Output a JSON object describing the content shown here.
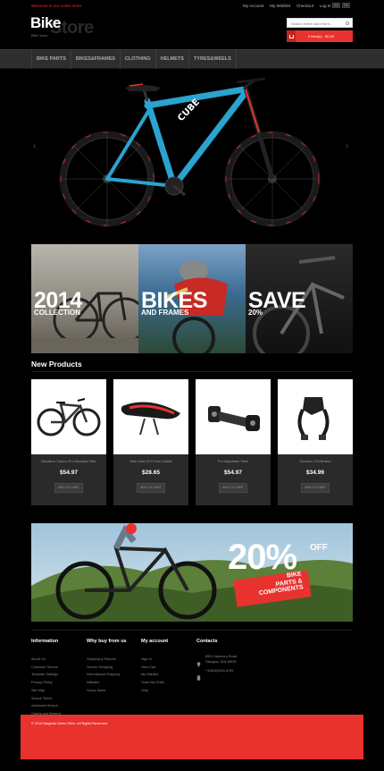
{
  "header": {
    "welcome": "Welcome to our online store",
    "links": [
      "My Account",
      "My Wishlist",
      "Checkout",
      "Log In"
    ],
    "lang": [
      "EN",
      "DE"
    ],
    "logo_main": "Bike",
    "logo_secondary": "Store",
    "logo_sub": "Bike Store",
    "search_placeholder": "Search entire store here...",
    "cart_label": "0 item(s) - $0.00"
  },
  "nav": [
    "BIKE PARTS",
    "BIKES&FRAMES",
    "CLOTHING",
    "HELMETS",
    "TYRES&WEELS"
  ],
  "banners": [
    {
      "big": "2014",
      "small": "COLLECTION"
    },
    {
      "big": "BIKES",
      "small": "AND FRAMES"
    },
    {
      "big": "SAVE",
      "small": "20%"
    }
  ],
  "new_products": {
    "title": "New Products",
    "button_label": "ADD TO CART",
    "items": [
      {
        "name": "Marathon Carbon Pro Mountain Bike",
        "price": "$54.97",
        "icon": "mountain-bike-icon"
      },
      {
        "name": "Selle Italia SLR Flow Saddle",
        "price": "$28.65",
        "icon": "saddle-icon"
      },
      {
        "name": "Pro Adjustable Stem",
        "price": "$54.97",
        "icon": "stem-icon"
      },
      {
        "name": "Shimano 105 Brakes",
        "price": "$34.99",
        "icon": "brake-icon"
      }
    ]
  },
  "promo": {
    "percent": "20%",
    "off": "OFF",
    "line1": "BIKE",
    "line2": "PARTS &",
    "line3": "COMPONENTS"
  },
  "footer": {
    "information": {
      "title": "Information",
      "items": [
        "About Us",
        "Customer Service",
        "Template Settings",
        "Privacy Policy",
        "Site Map",
        "Search Terms",
        "Advanced Search",
        "Orders and Returns",
        "Contact Us"
      ]
    },
    "why": {
      "title": "Why buy from us",
      "items": [
        "Shipping & Returns",
        "Secure Shopping",
        "International Shipping",
        "Affiliates",
        "Group Sales"
      ]
    },
    "account": {
      "title": "My account",
      "items": [
        "Sign In",
        "View Cart",
        "My Wishlist",
        "Track My Order",
        "Help"
      ]
    },
    "contacts": {
      "title": "Contacts",
      "address1": "8901 Marmora Road,",
      "address2": "Glasgow, D04 89GR",
      "phone": "+1(800)2345-6789"
    },
    "copyright": "© 2014 Magento Demo Store. All Rights Reserved."
  },
  "colors": {
    "accent": "#e8322e",
    "background": "#000000",
    "nav": "#2e2e2e",
    "bike_frame": "#2ba3cf"
  }
}
